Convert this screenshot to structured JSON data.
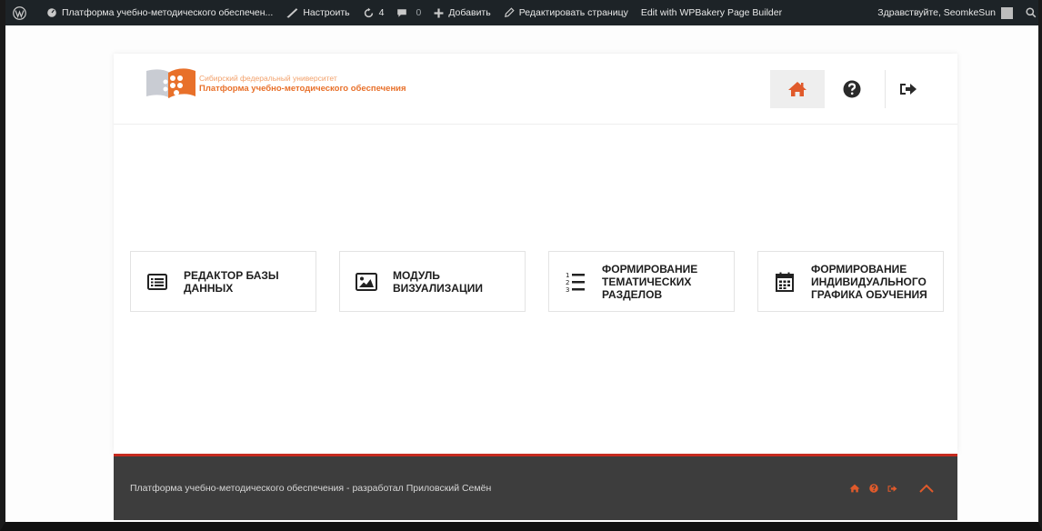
{
  "adminbar": {
    "site_name": "Платформа учебно-методического обеспечен...",
    "customize": "Настроить",
    "updates_count": "4",
    "comments_count": "0",
    "add_new": "Добавить",
    "edit_page": "Редактировать страницу",
    "wpbakery": "Edit with WPBakery Page Builder",
    "greeting": "Здравствуйте, SeomkeSun"
  },
  "header": {
    "logo_subtitle": "Сибирский федеральный университет",
    "logo_title": "Платформа учебно-методического обеспечения"
  },
  "tiles": [
    {
      "label_line1": "Редактор базы",
      "label_line2": "данных",
      "label_line3": "",
      "icon": "list-icon"
    },
    {
      "label_line1": "Модуль",
      "label_line2": "визуализации",
      "label_line3": "",
      "icon": "image-icon"
    },
    {
      "label_line1": "Формирование",
      "label_line2": "тематических",
      "label_line3": "разделов",
      "icon": "ordered-list-icon"
    },
    {
      "label_line1": "Формирование",
      "label_line2": "индивидуального",
      "label_line3": "графика обучения",
      "icon": "calendar-icon"
    }
  ],
  "footer": {
    "text": "Платформа учебно-методического обеспечения - разработал Приловский Семён"
  },
  "colors": {
    "accent_orange": "#e8702a",
    "footer_bg": "#3d3d3d",
    "footer_border": "#c62a1f",
    "home_icon_active": "#e05a2b"
  }
}
